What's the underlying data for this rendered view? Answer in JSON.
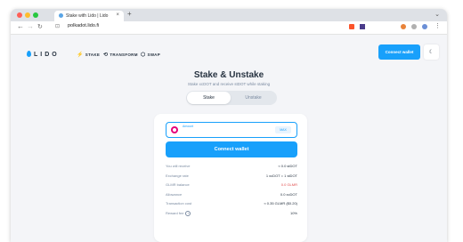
{
  "browser": {
    "tab_title": "Stake with Lido | Lido",
    "url": "polkadot.lido.fi",
    "traffic_colors": [
      "#ff5f57",
      "#febc2e",
      "#28c840"
    ]
  },
  "header": {
    "logo": "LIDO",
    "nav": [
      {
        "label": "STAKE",
        "icon": "stake-icon"
      },
      {
        "label": "TRANSFORM",
        "icon": "transform-icon"
      },
      {
        "label": "SWAP",
        "icon": "swap-icon"
      }
    ],
    "connect_label": "Connect wallet"
  },
  "main": {
    "title": "Stake & Unstake",
    "subtitle": "Stake xcDOT and receive stDOT while staking",
    "tabs": {
      "stake": "Stake",
      "unstake": "Unstake"
    },
    "amount": {
      "label": "Amount",
      "value": "",
      "max_label": "MAX"
    },
    "connect_label": "Connect wallet",
    "details": [
      {
        "label": "You will receive",
        "value": "≈ 0.0 stDOT"
      },
      {
        "label": "Exchange rate",
        "value": "1 xcDOT = 1 stDOT"
      },
      {
        "label": "GLMR balance",
        "value": "0.0 GLMR"
      },
      {
        "label": "Allowance",
        "value": "0.0 xcDOT"
      },
      {
        "label": "Transaction cost",
        "value": "≈ 0.35 GLMR ($0.20)"
      },
      {
        "label": "Reward fee",
        "value": "10%"
      }
    ]
  },
  "colors": {
    "accent": "#18a0fb",
    "warning": "#e14d4d"
  }
}
